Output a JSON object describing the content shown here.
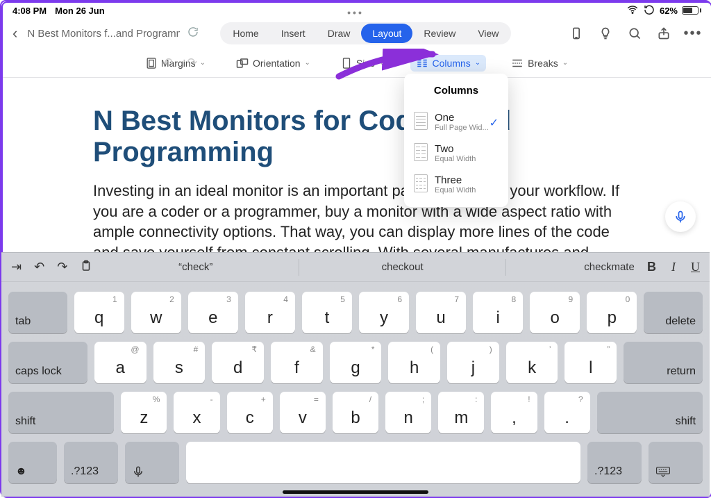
{
  "status": {
    "time": "4:08 PM",
    "date": "Mon 26 Jun",
    "battery_pct": "62%"
  },
  "header": {
    "doc_title": "N Best Monitors f...and Programming",
    "tabs": {
      "home": "Home",
      "insert": "Insert",
      "draw": "Draw",
      "layout": "Layout",
      "review": "Review",
      "view": "View"
    }
  },
  "toolbar": {
    "margins": "Margins",
    "orientation": "Orientation",
    "size": "Size",
    "columns": "Columns",
    "breaks": "Breaks"
  },
  "columns_popover": {
    "title": "Columns",
    "one": {
      "label": "One",
      "sub": "Full Page Wid..."
    },
    "two": {
      "label": "Two",
      "sub": "Equal Width"
    },
    "three": {
      "label": "Three",
      "sub": "Equal Width"
    }
  },
  "document": {
    "title": "N Best Monitors for Coding and Programming",
    "body": "Investing in an ideal monitor is an important part of improving your workflow. If you are a coder or a programmer, buy a monitor with a wide aspect ratio with ample connectivity options. That way, you can display more lines of the code and save yourself from constant scrolling. With several manufactures and"
  },
  "keyboard": {
    "suggestions": {
      "s1": "“check”",
      "s2": "checkout",
      "s3": "checkmate"
    },
    "row1": {
      "tab": "tab",
      "keys": [
        {
          "hint": "1",
          "ch": "q"
        },
        {
          "hint": "2",
          "ch": "w"
        },
        {
          "hint": "3",
          "ch": "e"
        },
        {
          "hint": "4",
          "ch": "r"
        },
        {
          "hint": "5",
          "ch": "t"
        },
        {
          "hint": "6",
          "ch": "y"
        },
        {
          "hint": "7",
          "ch": "u"
        },
        {
          "hint": "8",
          "ch": "i"
        },
        {
          "hint": "9",
          "ch": "o"
        },
        {
          "hint": "0",
          "ch": "p"
        }
      ],
      "delete": "delete"
    },
    "row2": {
      "caps": "caps lock",
      "keys": [
        {
          "hint": "@",
          "ch": "a"
        },
        {
          "hint": "#",
          "ch": "s"
        },
        {
          "hint": "₹",
          "ch": "d"
        },
        {
          "hint": "&",
          "ch": "f"
        },
        {
          "hint": "*",
          "ch": "g"
        },
        {
          "hint": "(",
          "ch": "h"
        },
        {
          "hint": ")",
          "ch": "j"
        },
        {
          "hint": "’",
          "ch": "k"
        },
        {
          "hint": "”",
          "ch": "l"
        }
      ],
      "return": "return"
    },
    "row3": {
      "shiftL": "shift",
      "keys": [
        {
          "hint": "%",
          "ch": "z"
        },
        {
          "hint": "-",
          "ch": "x"
        },
        {
          "hint": "+",
          "ch": "c"
        },
        {
          "hint": "=",
          "ch": "v"
        },
        {
          "hint": "/",
          "ch": "b"
        },
        {
          "hint": ";",
          "ch": "n"
        },
        {
          "hint": ":",
          "ch": "m"
        },
        {
          "hint": "!",
          "ch": ","
        },
        {
          "hint": "?",
          "ch": "."
        }
      ],
      "shiftR": "shift"
    },
    "row4": {
      "numL": ".?123",
      "numR": ".?123"
    },
    "format": {
      "bold": "B",
      "italic": "I",
      "underline": "U"
    }
  }
}
